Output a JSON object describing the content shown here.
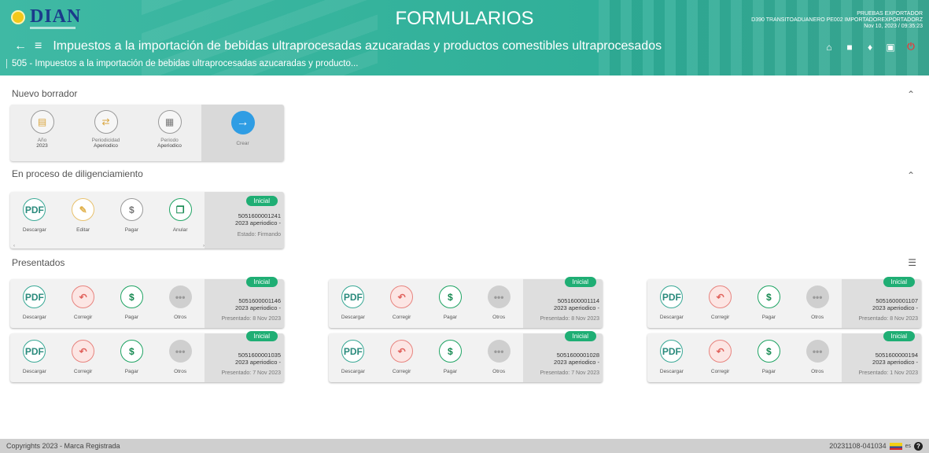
{
  "header": {
    "logo_text": "DIAN",
    "app_title": "FORMULARIOS",
    "user_line1": "PRUEBAS EXPORTADOR",
    "user_line2": "D390 TRANSITOADUANERO PE002 IMPORTADOREXPORTADORZ",
    "user_line3": "Nov 10, 2023 / 09:35:23",
    "back_icon": "arrow-left-icon",
    "menu_icon": "hamburger-menu-icon",
    "form_title": "Impuestos a la importación de bebidas ultraprocesadas azucaradas y productos comestibles ultraprocesados",
    "breadcrumb": "505 - Impuestos a la importación de bebidas ultraprocesadas azucaradas y producto...",
    "icons": [
      "home-icon",
      "folder-icon",
      "bell-icon",
      "calendar-icon",
      "power-icon"
    ]
  },
  "draft": {
    "title": "Nuevo borrador",
    "items": [
      {
        "label": "Año",
        "value": "2023",
        "icon": "calendar-icon"
      },
      {
        "label": "Periodicidad",
        "value": "Aperiodico",
        "icon": "repeat-icon"
      },
      {
        "label": "Periodo",
        "value": "Aperiodico",
        "icon": "calendar-grid-icon"
      }
    ],
    "create_label": "Crear"
  },
  "in_progress": {
    "title": "En proceso de diligenciamiento",
    "card": {
      "actions": [
        "Descargar",
        "Editar",
        "Pagar",
        "Anular"
      ],
      "badge": "Inicial",
      "number": "5051600001241",
      "period": "2023 aperiodico -",
      "status": "Estado: Firmando"
    }
  },
  "presented": {
    "title": "Presentados",
    "actions": [
      "Descargar",
      "Corregir",
      "Pagar",
      "Otros"
    ],
    "cards": [
      {
        "badge": "Inicial",
        "number": "5051600001146",
        "period": "2023 aperiodico -",
        "presented": "Presentado: 8 Nov 2023"
      },
      {
        "badge": "Inicial",
        "number": "5051600001114",
        "period": "2023 aperiodico -",
        "presented": "Presentado: 8 Nov 2023"
      },
      {
        "badge": "Inicial",
        "number": "5051600001107",
        "period": "2023 aperiodico -",
        "presented": "Presentado: 8 Nov 2023"
      },
      {
        "badge": "Inicial",
        "number": "5051600001035",
        "period": "2023 aperiodico -",
        "presented": "Presentado: 7 Nov 2023"
      },
      {
        "badge": "Inicial",
        "number": "5051600001028",
        "period": "2023 aperiodico -",
        "presented": "Presentado: 7 Nov 2023"
      },
      {
        "badge": "Inicial",
        "number": "5051600000194",
        "period": "2023 aperiodico -",
        "presented": "Presentado: 1 Nov 2023"
      }
    ]
  },
  "footer": {
    "copyright": "Copyrights 2023 - Marca Registrada",
    "version": "20231108-041034",
    "lang": "es"
  }
}
